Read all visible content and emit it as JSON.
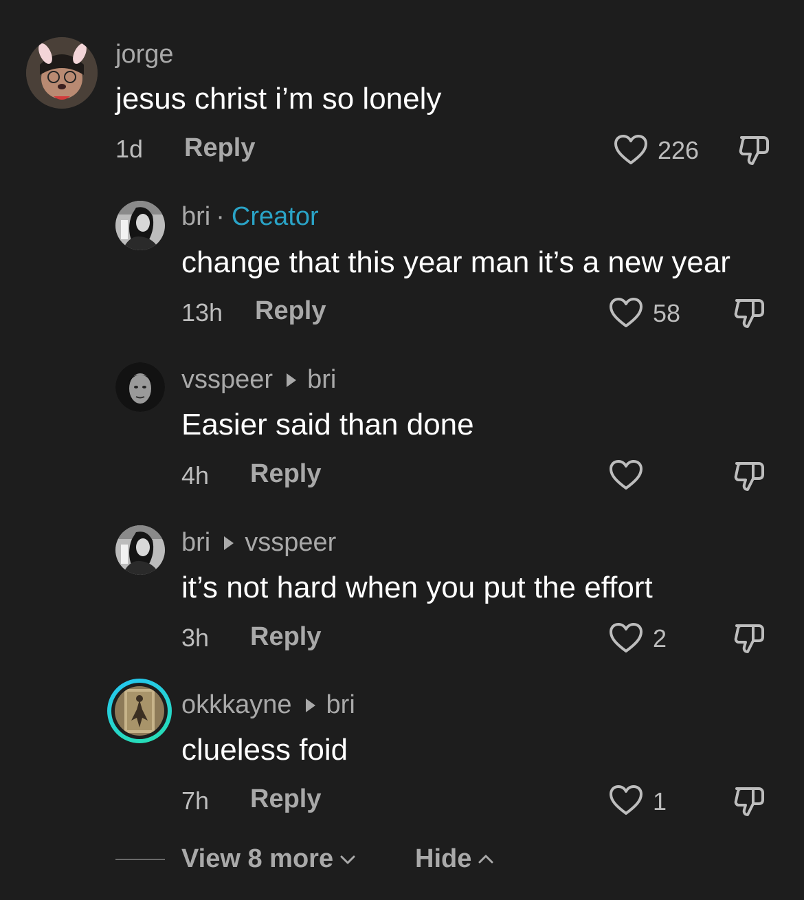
{
  "comments": [
    {
      "user": "jorge",
      "text": "jesus christ i’m so lonely",
      "time": "1d",
      "reply_label": "Reply",
      "likes": "226"
    },
    {
      "user": "bri",
      "separator": "·",
      "badge": "Creator",
      "text": "change that this year man it’s a new year",
      "time": "13h",
      "reply_label": "Reply",
      "likes": "58"
    },
    {
      "user": "vsspeer",
      "reply_to": "bri",
      "text": "Easier said than done",
      "time": "4h",
      "reply_label": "Reply",
      "likes": ""
    },
    {
      "user": "bri",
      "reply_to": "vsspeer",
      "text": "it’s not hard when you put the effort",
      "time": "3h",
      "reply_label": "Reply",
      "likes": "2"
    },
    {
      "user": "okkkayne",
      "reply_to": "bri",
      "text": "clueless foid",
      "time": "7h",
      "reply_label": "Reply",
      "likes": "1"
    }
  ],
  "footer": {
    "view_more": "View 8 more",
    "hide": "Hide"
  },
  "colors": {
    "background": "#1d1d1d",
    "creator_badge": "#2aa3c6",
    "story_ring_start": "#25c5f4",
    "story_ring_end": "#27e0b0"
  },
  "icons": {
    "like": "heart-outline-icon",
    "dislike": "thumbs-down-icon",
    "reply_arrow": "triangle-right-icon",
    "expand": "chevron-down-icon",
    "collapse": "chevron-up-icon"
  }
}
